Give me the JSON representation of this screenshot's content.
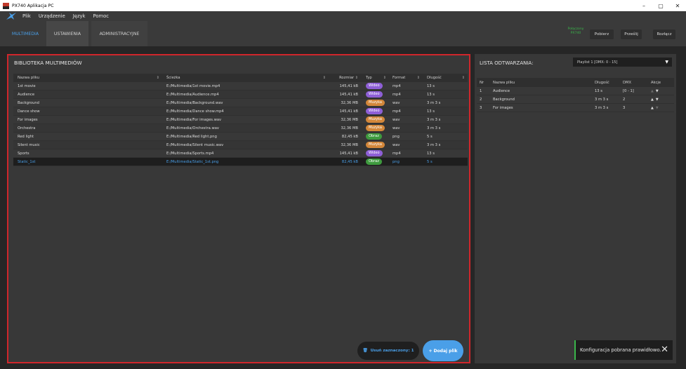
{
  "window": {
    "title": "PX740 Aplikacja PC",
    "controls": [
      "–",
      "▢",
      "✕"
    ]
  },
  "menu": [
    "Plik",
    "Urządzenie",
    "Język",
    "Pomoc"
  ],
  "tabs": [
    "MULTIMEDIA",
    "USTAWIENIA",
    "ADMINISTRACYJNE"
  ],
  "connection": {
    "line1": "Połączony",
    "line2": "PX740"
  },
  "top_buttons": [
    "Pobierz",
    "Prześlij",
    "Rozłącz"
  ],
  "library": {
    "title": "BIBLIOTEKA MULTIMEDIÓW",
    "columns": [
      "Nazwa pliku",
      "Ścieżka",
      "Rozmiar",
      "Typ",
      "Format",
      "Długość"
    ],
    "rows": [
      {
        "name": "1st movie",
        "path": "E:/Multimedia/1st movie.mp4",
        "size": "145,41 kB",
        "type": "Wideo",
        "format": "mp4",
        "length": "13 s"
      },
      {
        "name": "Audience",
        "path": "E:/Multimedia/Audience.mp4",
        "size": "145,41 kB",
        "type": "Wideo",
        "format": "mp4",
        "length": "13 s"
      },
      {
        "name": "Background",
        "path": "E:/Multimedia/Background.wav",
        "size": "32,36 MB",
        "type": "Muzyka",
        "format": "wav",
        "length": "3 m 3 s"
      },
      {
        "name": "Dance show",
        "path": "E:/Multimedia/Dance show.mp4",
        "size": "145,41 kB",
        "type": "Wideo",
        "format": "mp4",
        "length": "13 s"
      },
      {
        "name": "For images",
        "path": "E:/Multimedia/For images.wav",
        "size": "32,36 MB",
        "type": "Muzyka",
        "format": "wav",
        "length": "3 m 3 s"
      },
      {
        "name": "Orchestra",
        "path": "E:/Multimedia/Orchestra.wav",
        "size": "32,36 MB",
        "type": "Muzyka",
        "format": "wav",
        "length": "3 m 3 s"
      },
      {
        "name": "Red light",
        "path": "E:/Multimedia/Red light.png",
        "size": "82,45 kB",
        "type": "Obraz",
        "format": "png",
        "length": "5 s"
      },
      {
        "name": "Silent music",
        "path": "E:/Multimedia/Silent music.wav",
        "size": "32,36 MB",
        "type": "Muzyka",
        "format": "wav",
        "length": "3 m 3 s"
      },
      {
        "name": "Sports",
        "path": "E:/Multimedia/Sports.mp4",
        "size": "145,41 kB",
        "type": "Wideo",
        "format": "mp4",
        "length": "13 s"
      },
      {
        "name": "Static_1st",
        "path": "E:/Multimedia/Static_1st.png",
        "size": "82,45 kB",
        "type": "Obraz",
        "format": "png",
        "length": "5 s"
      }
    ],
    "delete_label": "Usuń zaznaczony: 1",
    "add_label": "+ Dodaj plik"
  },
  "playlist": {
    "title": "LISTA ODTWARZANIA:",
    "selected": "Playlist 1 [DMX: 0 - 15]",
    "columns": [
      "Nr",
      "Nazwa pliku",
      "Długość",
      "DMX",
      "Akcje"
    ],
    "rows": [
      {
        "nr": "1",
        "name": "Audience",
        "length": "13 s",
        "dmx": "[0 - 1]"
      },
      {
        "nr": "2",
        "name": "Background",
        "length": "3 m 3 s",
        "dmx": "2"
      },
      {
        "nr": "3",
        "name": "For images",
        "length": "3 m 3 s",
        "dmx": "3"
      }
    ]
  },
  "toast": {
    "message": "Konfiguracja pobrana prawidłowo."
  },
  "colors": {
    "accent": "#4a9fe8",
    "highlight": "#d0262b",
    "video": "#8e5fd6",
    "music": "#d3873a",
    "image": "#3e9a3e",
    "connected": "#39b54a"
  }
}
